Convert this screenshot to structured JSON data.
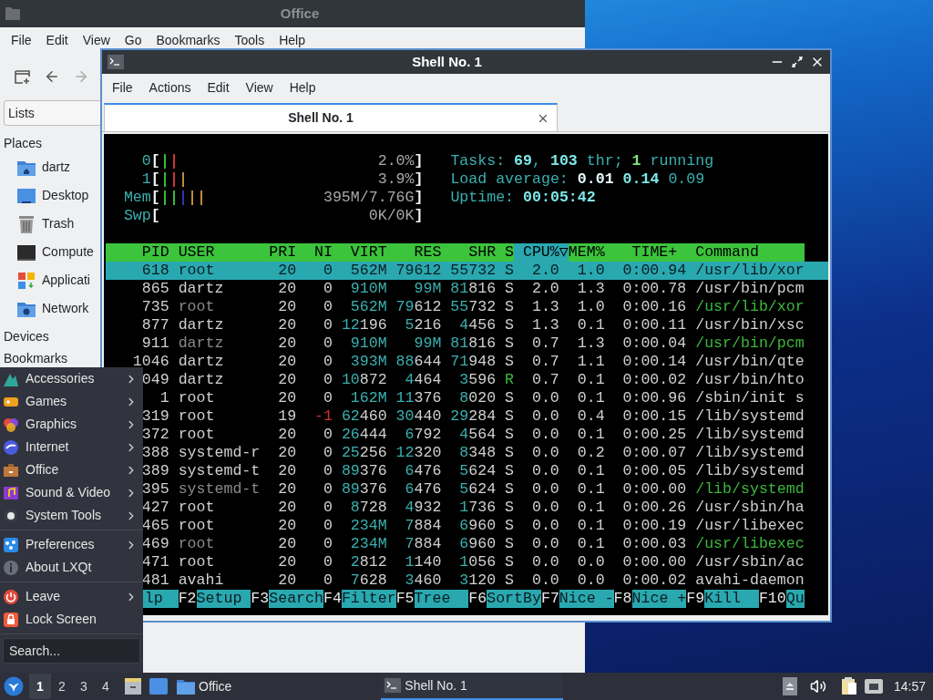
{
  "file_manager": {
    "title": "Office",
    "menu": [
      "File",
      "Edit",
      "View",
      "Go",
      "Bookmarks",
      "Tools",
      "Help"
    ],
    "sidebar": {
      "mode": "Lists",
      "sections": [
        {
          "heading": "Places",
          "items": [
            {
              "label": "dartz",
              "kind": "home"
            },
            {
              "label": "Desktop",
              "kind": "desktop"
            },
            {
              "label": "Trash",
              "kind": "trash"
            },
            {
              "label": "Compute",
              "kind": "computer"
            },
            {
              "label": "Applicati",
              "kind": "apps"
            },
            {
              "label": "Network",
              "kind": "network"
            }
          ]
        },
        {
          "heading": "Devices"
        },
        {
          "heading": "Bookmarks"
        }
      ]
    }
  },
  "terminal": {
    "title": "Shell No. 1",
    "menu": [
      "File",
      "Actions",
      "Edit",
      "View",
      "Help"
    ],
    "tabs": [
      {
        "label": "Shell No. 1",
        "selected": true
      }
    ],
    "htop": {
      "meters": [
        {
          "label": "0",
          "open": "[",
          "value": "2.0%",
          "close": "]",
          "segments": [
            {
              "color": "#33bb33"
            },
            {
              "color": "#cc3333"
            }
          ]
        },
        {
          "label": "1",
          "open": "[",
          "value": "3.9%",
          "close": "]",
          "segments": [
            {
              "color": "#33bb33"
            },
            {
              "color": "#cc3333"
            },
            {
              "color": "#c08a3a"
            }
          ]
        },
        {
          "label": "Mem",
          "open": "[",
          "value": "395M/7.76G",
          "close": "]",
          "segments": [
            {
              "color": "#33bb33"
            },
            {
              "color": "#33bb33"
            },
            {
              "color": "#3333aa"
            },
            {
              "color": "#c08a3a"
            },
            {
              "color": "#c08a3a"
            }
          ]
        },
        {
          "label": "Swp",
          "open": "[",
          "value": "0K/0K",
          "close": "]"
        }
      ],
      "summary": [
        {
          "segments": [
            {
              "text": "Tasks: ",
              "color": "#3ab0b0",
              "bold": false
            },
            {
              "text": "69",
              "color": "#7fe8e8",
              "bold": true
            },
            {
              "text": ", ",
              "color": "#3ab0b0",
              "bold": false
            },
            {
              "text": "103",
              "color": "#7fe8e8",
              "bold": true
            },
            {
              "text": " thr; ",
              "color": "#3ab0b0",
              "bold": false
            },
            {
              "text": "1",
              "color": "#7fe87f",
              "bold": true
            },
            {
              "text": " running",
              "color": "#3ab0b0",
              "bold": false
            }
          ]
        },
        {
          "segments": [
            {
              "text": "Load average: ",
              "color": "#3ab0b0",
              "bold": false
            },
            {
              "text": "0.01 ",
              "color": "#e8ffff",
              "bold": true
            },
            {
              "text": "0.14 ",
              "color": "#7fe8e8",
              "bold": true
            },
            {
              "text": "0.09",
              "color": "#3ab0b0",
              "bold": false
            }
          ]
        },
        {
          "segments": [
            {
              "text": "Uptime: ",
              "color": "#3ab0b0",
              "bold": false
            },
            {
              "text": "00:05:42",
              "color": "#7fe8e8",
              "bold": true
            }
          ]
        }
      ],
      "columns": [
        {
          "label": "PID",
          "sorted": false
        },
        {
          "label": "USER",
          "sorted": false
        },
        {
          "label": "PRI",
          "sorted": false
        },
        {
          "label": "NI",
          "sorted": false
        },
        {
          "label": "VIRT",
          "sorted": false
        },
        {
          "label": "RES",
          "sorted": false
        },
        {
          "label": "SHR",
          "sorted": false
        },
        {
          "label": "S",
          "sorted": false
        },
        {
          "label": "CPU%▽",
          "sorted": true
        },
        {
          "label": "MEM%",
          "sorted": false
        },
        {
          "label": "TIME+",
          "sorted": false
        },
        {
          "label": "Command",
          "sorted": false
        }
      ],
      "processes": [
        {
          "cells": [
            "618",
            "root",
            "20",
            "0",
            "562M",
            "79612",
            "55732",
            "S",
            "2.0",
            "1.0",
            "0:00.94",
            "/usr/lib/xor"
          ],
          "selected": true,
          "thread": false,
          "running": false,
          "boosted": false
        },
        {
          "cells": [
            "865",
            "dartz",
            "20",
            "0",
            "910M",
            "99M",
            "81816",
            "S",
            "2.0",
            "1.3",
            "0:00.78",
            "/usr/bin/pcm"
          ],
          "selected": false,
          "thread": false,
          "running": false,
          "boosted": false
        },
        {
          "cells": [
            "735",
            "root",
            "20",
            "0",
            "562M",
            "79612",
            "55732",
            "S",
            "1.3",
            "1.0",
            "0:00.16",
            "/usr/lib/xor"
          ],
          "selected": false,
          "thread": true,
          "running": false,
          "boosted": false
        },
        {
          "cells": [
            "877",
            "dartz",
            "20",
            "0",
            "12196",
            "5216",
            "4456",
            "S",
            "1.3",
            "0.1",
            "0:00.11",
            "/usr/bin/xsc"
          ],
          "selected": false,
          "thread": false,
          "running": false,
          "boosted": false
        },
        {
          "cells": [
            "911",
            "dartz",
            "20",
            "0",
            "910M",
            "99M",
            "81816",
            "S",
            "0.7",
            "1.3",
            "0:00.04",
            "/usr/bin/pcm"
          ],
          "selected": false,
          "thread": true,
          "running": false,
          "boosted": false
        },
        {
          "cells": [
            "1046",
            "dartz",
            "20",
            "0",
            "393M",
            "88644",
            "71948",
            "S",
            "0.7",
            "1.1",
            "0:00.14",
            "/usr/bin/qte"
          ],
          "selected": false,
          "thread": false,
          "running": false,
          "boosted": false
        },
        {
          "cells": [
            "049",
            "dartz",
            "20",
            "0",
            "10872",
            "4464",
            "3596",
            "R",
            "0.7",
            "0.1",
            "0:00.02",
            "/usr/bin/hto"
          ],
          "selected": false,
          "thread": false,
          "running": true,
          "boosted": false
        },
        {
          "cells": [
            "1",
            "root",
            "20",
            "0",
            "162M",
            "11376",
            "8020",
            "S",
            "0.0",
            "0.1",
            "0:00.96",
            "/sbin/init s"
          ],
          "selected": false,
          "thread": false,
          "running": false,
          "boosted": false
        },
        {
          "cells": [
            "319",
            "root",
            "19",
            "-1",
            "62460",
            "30440",
            "29284",
            "S",
            "0.0",
            "0.4",
            "0:00.15",
            "/lib/systemd"
          ],
          "selected": false,
          "thread": false,
          "running": false,
          "boosted": true
        },
        {
          "cells": [
            "372",
            "root",
            "20",
            "0",
            "26444",
            "6792",
            "4564",
            "S",
            "0.0",
            "0.1",
            "0:00.25",
            "/lib/systemd"
          ],
          "selected": false,
          "thread": false,
          "running": false,
          "boosted": false
        },
        {
          "cells": [
            "388",
            "systemd-r",
            "20",
            "0",
            "25256",
            "12320",
            "8348",
            "S",
            "0.0",
            "0.2",
            "0:00.07",
            "/lib/systemd"
          ],
          "selected": false,
          "thread": false,
          "running": false,
          "boosted": false
        },
        {
          "cells": [
            "389",
            "systemd-t",
            "20",
            "0",
            "89376",
            "6476",
            "5624",
            "S",
            "0.0",
            "0.1",
            "0:00.05",
            "/lib/systemd"
          ],
          "selected": false,
          "thread": false,
          "running": false,
          "boosted": false
        },
        {
          "cells": [
            "395",
            "systemd-t",
            "20",
            "0",
            "89376",
            "6476",
            "5624",
            "S",
            "0.0",
            "0.1",
            "0:00.00",
            "/lib/systemd"
          ],
          "selected": false,
          "thread": true,
          "running": false,
          "boosted": false
        },
        {
          "cells": [
            "427",
            "root",
            "20",
            "0",
            "8728",
            "4932",
            "1736",
            "S",
            "0.0",
            "0.1",
            "0:00.26",
            "/usr/sbin/ha"
          ],
          "selected": false,
          "thread": false,
          "running": false,
          "boosted": false
        },
        {
          "cells": [
            "465",
            "root",
            "20",
            "0",
            "234M",
            "7884",
            "6960",
            "S",
            "0.0",
            "0.1",
            "0:00.19",
            "/usr/libexec"
          ],
          "selected": false,
          "thread": false,
          "running": false,
          "boosted": false
        },
        {
          "cells": [
            "469",
            "root",
            "20",
            "0",
            "234M",
            "7884",
            "6960",
            "S",
            "0.0",
            "0.1",
            "0:00.03",
            "/usr/libexec"
          ],
          "selected": false,
          "thread": true,
          "running": false,
          "boosted": false
        },
        {
          "cells": [
            "471",
            "root",
            "20",
            "0",
            "2812",
            "1140",
            "1056",
            "S",
            "0.0",
            "0.0",
            "0:00.00",
            "/usr/sbin/ac"
          ],
          "selected": false,
          "thread": false,
          "running": false,
          "boosted": false
        },
        {
          "cells": [
            "481",
            "avahi",
            "20",
            "0",
            "7628",
            "3460",
            "3120",
            "S",
            "0.0",
            "0.0",
            "0:00.02",
            "avahi-daemon"
          ],
          "selected": false,
          "thread": false,
          "running": false,
          "boosted": false
        }
      ],
      "function_keys": [
        {
          "label": "lp"
        },
        {
          "key": "F2",
          "label": "Setup"
        },
        {
          "key": "F3",
          "label": "Search"
        },
        {
          "key": "F4",
          "label": "Filter"
        },
        {
          "key": "F5",
          "label": "Tree"
        },
        {
          "key": "F6",
          "label": "SortBy"
        },
        {
          "key": "F7",
          "label": "Nice -"
        },
        {
          "key": "F8",
          "label": "Nice +"
        },
        {
          "key": "F9",
          "label": "Kill"
        },
        {
          "key": "F10",
          "label": "Qu"
        }
      ]
    }
  },
  "start_menu": {
    "groups": [
      [
        {
          "label": "Accessories",
          "kind": "accessories",
          "submenu": true
        },
        {
          "label": "Games",
          "kind": "games",
          "submenu": true
        },
        {
          "label": "Graphics",
          "kind": "graphics",
          "submenu": true
        },
        {
          "label": "Internet",
          "kind": "internet",
          "submenu": true
        },
        {
          "label": "Office",
          "kind": "office",
          "submenu": true
        },
        {
          "label": "Sound & Video",
          "kind": "media",
          "submenu": true
        },
        {
          "label": "System Tools",
          "kind": "system",
          "submenu": true
        }
      ],
      [
        {
          "label": "Preferences",
          "kind": "preferences",
          "submenu": true
        },
        {
          "label": "About LXQt",
          "kind": "about",
          "submenu": false
        }
      ],
      [
        {
          "label": "Leave",
          "kind": "leave",
          "submenu": true
        },
        {
          "label": "Lock Screen",
          "kind": "lock",
          "submenu": false
        }
      ]
    ],
    "search": {
      "placeholder": "Search..."
    }
  },
  "taskbar": {
    "desktops": [
      {
        "label": "1",
        "selected": true
      },
      {
        "label": "2",
        "selected": false
      },
      {
        "label": "3",
        "selected": false
      },
      {
        "label": "4",
        "selected": false
      }
    ],
    "tasks": [
      {
        "label": "Office",
        "kind": "folder",
        "active": false
      },
      {
        "label": "Shell No. 1",
        "kind": "terminal",
        "active": true
      }
    ],
    "clock": "14:57"
  }
}
